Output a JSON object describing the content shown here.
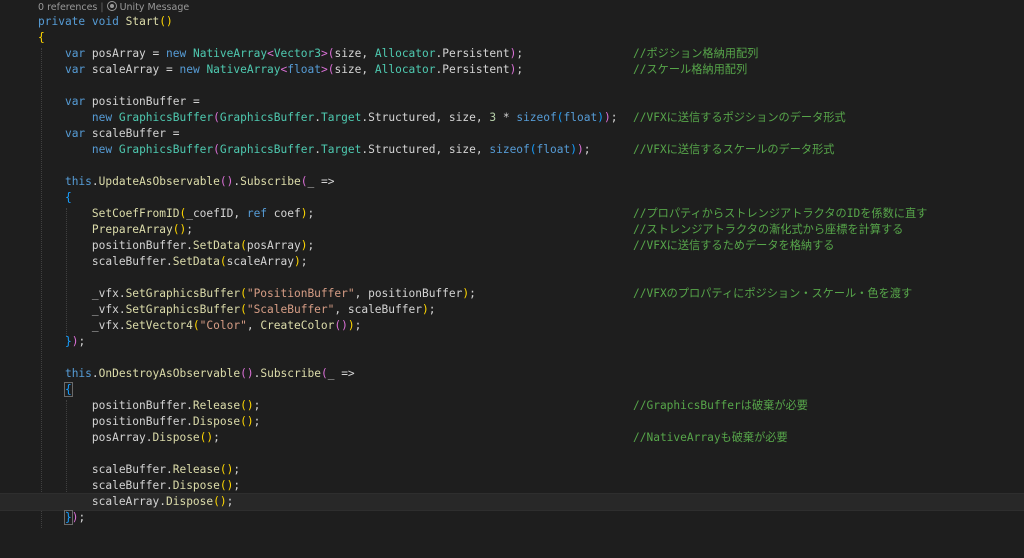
{
  "codelens": {
    "references": "0 references",
    "separator": "|",
    "unity_message": "Unity Message",
    "icon": "unity-message-icon"
  },
  "comments": {
    "pos_array": "//ポジション格納用配列",
    "scale_array": "//スケール格納用配列",
    "position_buffer": "//VFXに送信するポジションのデータ形式",
    "scale_buffer": "//VFXに送信するスケールのデータ形式",
    "set_coef": "//プロパティからストレンジアトラクタのIDを係数に直す",
    "prepare_array": "//ストレンジアトラクタの漸化式から座標を計算する",
    "set_data": "//VFXに送信するためデータを格納する",
    "set_graphics_buffer": "//VFXのプロパティにポジション・スケール・色を渡す",
    "release": "//GraphicsBufferは破棄が必要",
    "native_dispose": "//NativeArrayも破棄が必要"
  },
  "colors": {
    "background": "#1e1e1e",
    "keyword": "#569cd6",
    "type": "#4ec9b0",
    "method": "#dcdcaa",
    "string": "#d69d85",
    "number": "#b5cea8",
    "comment": "#57a64a",
    "text": "#d4d4d4"
  }
}
